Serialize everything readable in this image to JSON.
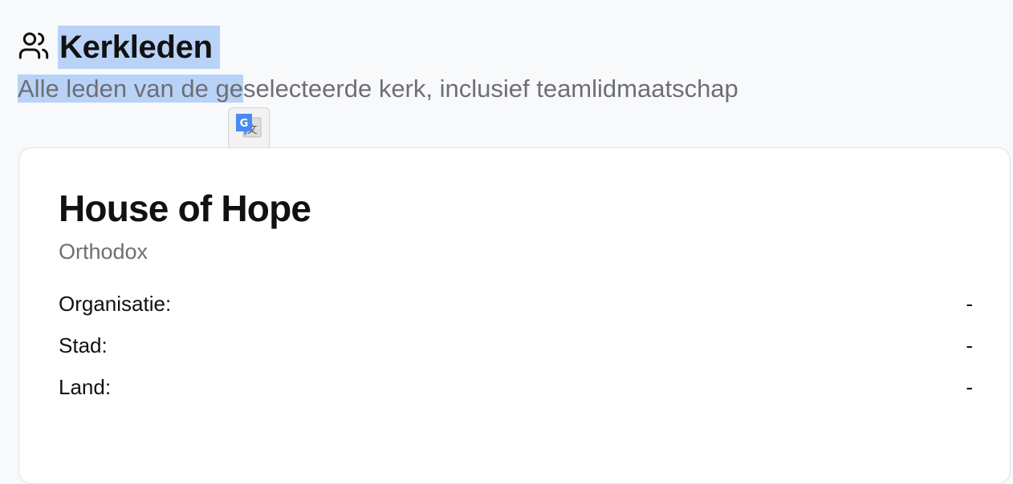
{
  "header": {
    "title": "Kerkleden",
    "icon": "users-icon",
    "subtitle_selected": "Alle leden van de ge",
    "subtitle_rest": "selecteerde kerk, inclusief teamlidmaatschap"
  },
  "translate_popup": {
    "icon": "google-translate-icon"
  },
  "church": {
    "name": "House of Hope",
    "type": "Orthodox",
    "fields": [
      {
        "label": "Organisatie:",
        "value": "-"
      },
      {
        "label": "Stad:",
        "value": "-"
      },
      {
        "label": "Land:",
        "value": "-"
      }
    ]
  },
  "colors": {
    "selection": "#b9d3f8",
    "background": "#f8f9fb",
    "muted_text": "#6d6f73"
  }
}
